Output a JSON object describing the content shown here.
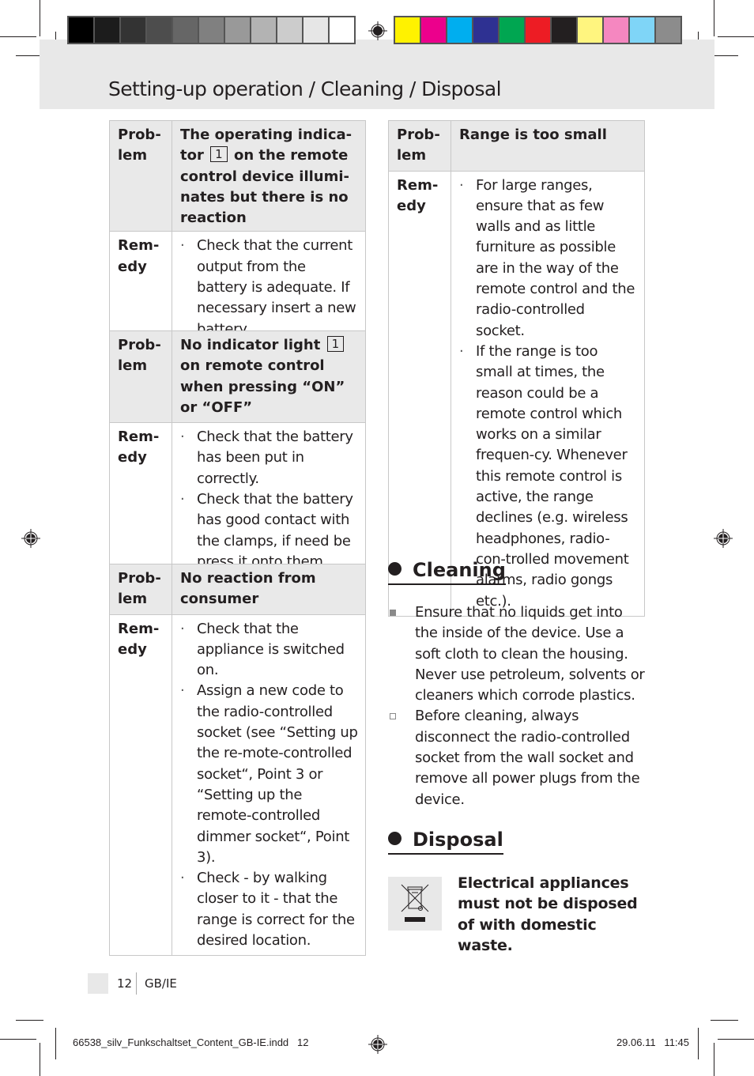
{
  "header": {
    "title": "Setting-up operation / Cleaning / Disposal"
  },
  "print_marks": {
    "gray_swatches": [
      "#000000",
      "#1c1c1c",
      "#333333",
      "#4d4d4d",
      "#666666",
      "#808080",
      "#999999",
      "#b3b3b3",
      "#cccccc",
      "#e6e6e6",
      "#ffffff"
    ],
    "color_swatches": [
      "#fff200",
      "#ec008c",
      "#00aeef",
      "#2e3192",
      "#00a651",
      "#ed1c24",
      "#231f20",
      "#fff57f",
      "#f587c0",
      "#7fd5f7",
      "#8c8c8c"
    ]
  },
  "troubleshooting": {
    "problem_label": "Prob-lem",
    "problem_label_line1": "Prob-",
    "problem_label_line2": "lem",
    "remedy_label_line1": "Rem-",
    "remedy_label_line2": "edy",
    "tables": [
      {
        "problem_pre": "The operating indica-tor",
        "problem_ref": "1",
        "problem_post": "on the remote control device illumi-nates but there is no reaction",
        "remedies": [
          "Check that the current output from the battery is adequate. If necessary insert a new battery."
        ]
      },
      {
        "problem_pre": "No indicator light",
        "problem_ref": "1",
        "problem_post": "on remote control when pressing “ON” or “OFF”",
        "remedies": [
          "Check that the battery has been put in correctly.",
          "Check that the battery has good contact with the clamps, if need be press it onto them."
        ]
      },
      {
        "problem": "No reaction from consumer",
        "remedies": [
          "Check that the appliance is switched on.",
          "Assign a new code to the radio-controlled socket (see “Setting up the re-mote-controlled socket“, Point 3 or “Setting up the remote-controlled dimmer socket“, Point 3).",
          "Check - by walking closer to it - that the range is correct for the desired location."
        ]
      },
      {
        "problem": "Range is too small",
        "remedies": [
          "For large ranges, ensure that as few walls and as little furniture as possible are in the way of the remote control and the radio-controlled socket.",
          "If the range is too small at times, the reason could be a remote control which works on a similar frequen-cy. Whenever this remote control is active, the range declines (e.g. wireless headphones, radio-con-trolled movement alarms, radio gongs etc.)."
        ]
      }
    ]
  },
  "cleaning": {
    "heading": "Cleaning",
    "items": [
      "Ensure that no liquids get into the inside of the device. Use a soft cloth to clean the housing. Never use petroleum, solvents or cleaners which corrode plastics.",
      "Before cleaning, always disconnect the radio-controlled socket from the wall socket and remove all power plugs from the device."
    ]
  },
  "disposal": {
    "heading": "Disposal",
    "icon": "crossed-out-wheelie-bin-icon",
    "warning": "Electrical appliances must not be disposed of with domestic waste."
  },
  "footer": {
    "page_number": "12",
    "language": "GB/IE",
    "slug_file": "66538_silv_Funkschaltset_Content_GB-IE.indd   12",
    "slug_date": "29.06.11   11:45"
  }
}
